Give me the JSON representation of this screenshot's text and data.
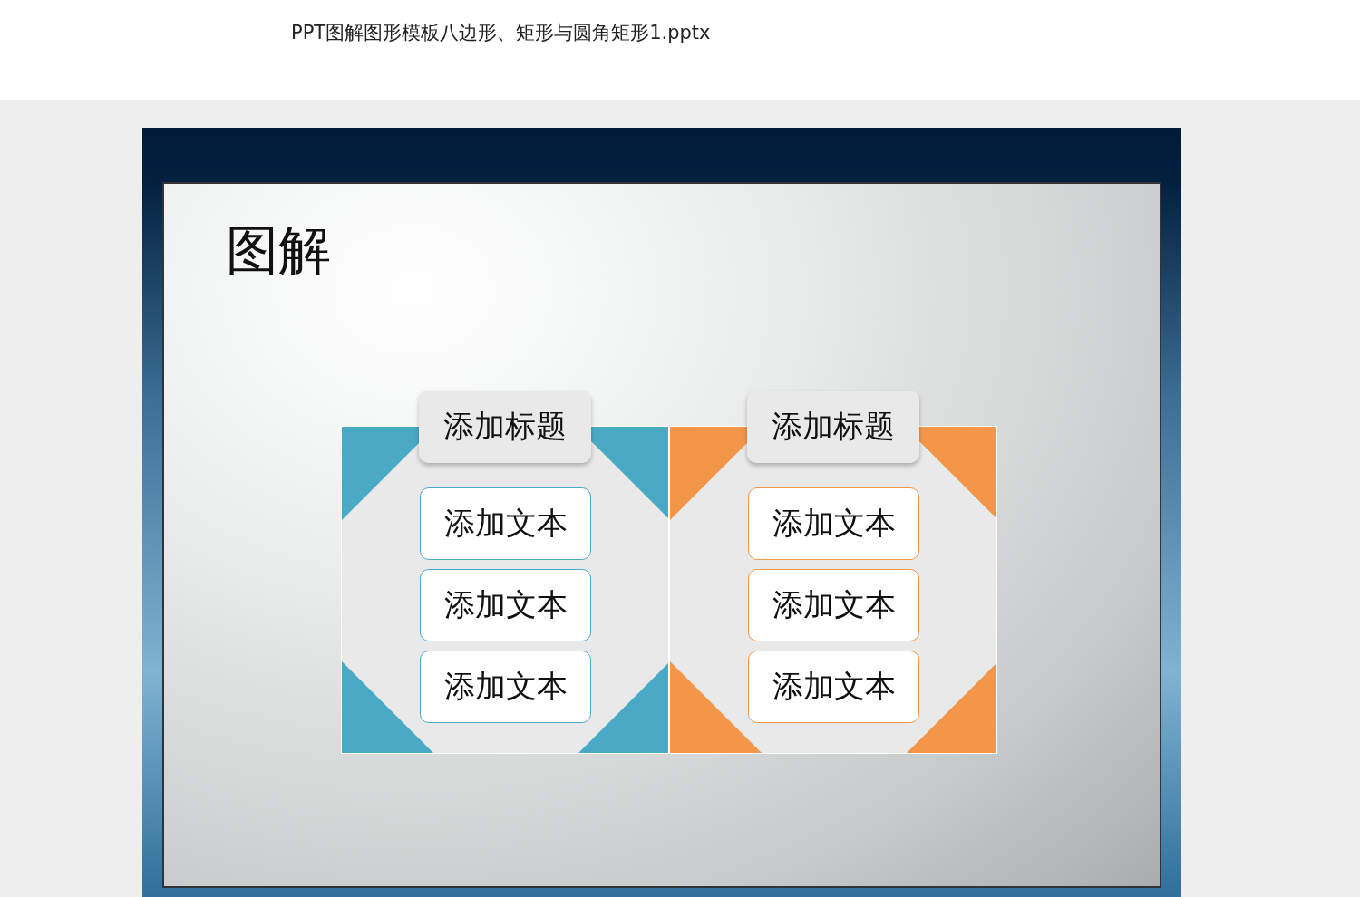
{
  "window": {
    "title": "PPT图解图形模板八边形、矩形与圆角矩形1.pptx"
  },
  "slide": {
    "title": "图解",
    "panels": [
      {
        "color": "#4aaac6",
        "heading": "添加标题",
        "items": [
          "添加文本",
          "添加文本",
          "添加文本"
        ]
      },
      {
        "color": "#f4964a",
        "heading": "添加标题",
        "items": [
          "添加文本",
          "添加文本",
          "添加文本"
        ]
      }
    ]
  }
}
